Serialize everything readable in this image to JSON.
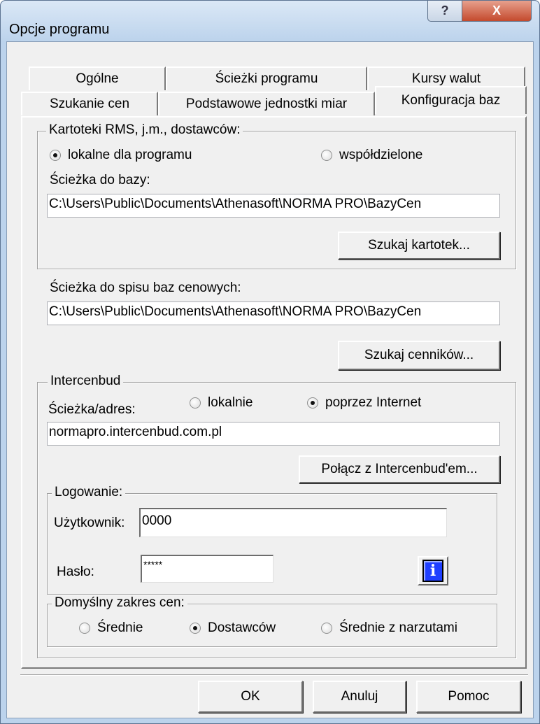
{
  "window": {
    "title": "Opcje programu",
    "help_glyph": "?",
    "close_glyph": "X"
  },
  "tabs": {
    "row1": [
      "Ogólne",
      "Ścieżki programu",
      "Kursy walut"
    ],
    "row2": [
      "Szukanie cen",
      "Podstawowe jednostki miar",
      "Konfiguracja baz"
    ],
    "active": "Konfiguracja baz"
  },
  "kartoteki": {
    "legend": "Kartoteki RMS, j.m., dostawców:",
    "radio_local": "lokalne dla programu",
    "radio_shared": "współdzielone",
    "selected": "lokalne dla programu",
    "path_label": "Ścieżka do bazy:",
    "path_value": "C:\\Users\\Public\\Documents\\Athenasoft\\NORMA PRO\\BazyCen",
    "search_button": "Szukaj kartotek..."
  },
  "spis": {
    "path_label": "Ścieżka do spisu baz cenowych:",
    "path_value": "C:\\Users\\Public\\Documents\\Athenasoft\\NORMA PRO\\BazyCen",
    "search_button": "Szukaj cenników..."
  },
  "intercenbud": {
    "legend": "Intercenbud",
    "radio_local": "lokalnie",
    "radio_internet": "poprzez Internet",
    "selected": "poprzez Internet",
    "address_label": "Ścieżka/adres:",
    "address_value": "normapro.intercenbud.com.pl",
    "connect_button": "Połącz z Intercenbud'em..."
  },
  "logowanie": {
    "legend": "Logowanie:",
    "user_label": "Użytkownik:",
    "user_value": "0000",
    "password_label": "Hasło:",
    "password_value": "*****",
    "info_glyph": "i"
  },
  "zakres": {
    "legend": "Domyślny zakres cen:",
    "options": [
      "Średnie",
      "Dostawców",
      "Średnie z narzutami"
    ],
    "selected": "Dostawców"
  },
  "buttons": {
    "ok": "OK",
    "cancel": "Anuluj",
    "help": "Pomoc"
  }
}
